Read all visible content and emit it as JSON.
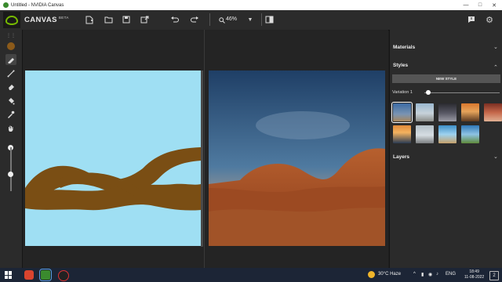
{
  "window": {
    "title": "Untitled - NVIDIA Canvas"
  },
  "app": {
    "name": "CANVAS",
    "beta": "BETA"
  },
  "toolbar": {
    "zoom_value": "46%",
    "buttons": [
      "new-file-icon",
      "open-folder-icon",
      "save-icon",
      "export-icon",
      "undo-icon",
      "redo-icon",
      "zoom-dropdown-chevron",
      "panel-layout-icon",
      "feedback-icon",
      "settings-icon"
    ]
  },
  "tools": [
    "brush-color",
    "brush",
    "line",
    "eraser",
    "fill",
    "eyedropper",
    "pan"
  ],
  "brush_color": "#8b5a1a",
  "sidebar": {
    "materials": "Materials",
    "styles": "Styles",
    "new_style": "NEW STYLE",
    "variation": "Variation 1",
    "variation_level": 0.05,
    "layers": "Layers"
  },
  "colors": {
    "accent": "#76b900",
    "sky": "#9fdff3",
    "dirt": "#7a4e14"
  },
  "taskbar": {
    "temperature": "30°C Haze",
    "lang": "ENG",
    "time": "18:49",
    "date": "11-08-2022",
    "notifications": "2"
  }
}
